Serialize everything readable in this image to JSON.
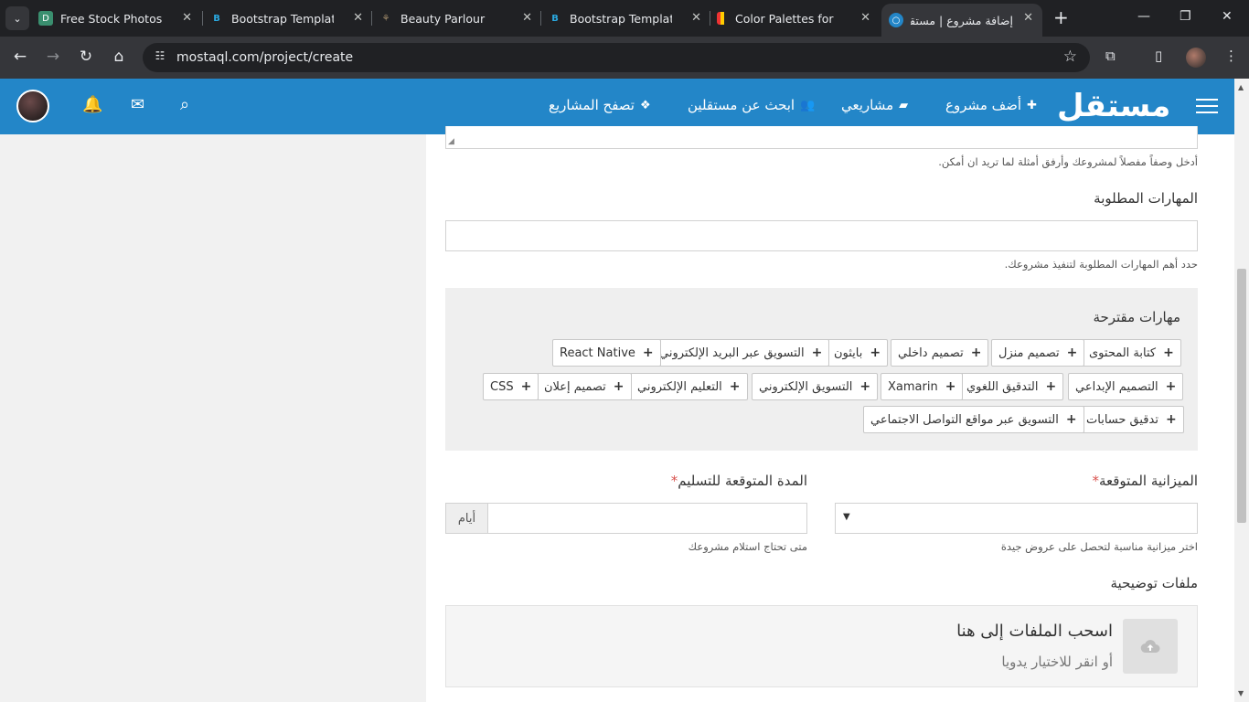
{
  "browser": {
    "tabs": [
      {
        "title": "Free Stock Photos, Ro",
        "favicon": "d-letter-icon"
      },
      {
        "title": "Bootstrap Templates |",
        "favicon": "bootstrap-icon"
      },
      {
        "title": "Beauty Parlour",
        "favicon": "plant-icon"
      },
      {
        "title": "Bootstrap Templates |",
        "favicon": "bootstrap-icon"
      },
      {
        "title": "Color Palettes for De",
        "favicon": "palette-icon"
      },
      {
        "title": "إضافة مشروع | مستقل",
        "favicon": "mostaql-icon",
        "active": true
      }
    ],
    "url": "mostaql.com/project/create"
  },
  "header": {
    "logo": "مستقل",
    "nav": [
      {
        "label": "أضف مشروع",
        "icon": "plus-icon"
      },
      {
        "label": "مشاريعي",
        "icon": "folder-open-icon"
      },
      {
        "label": "ابحث عن مستقلين",
        "icon": "users-icon"
      },
      {
        "label": "تصفح المشاريع",
        "icon": "cubes-icon"
      }
    ],
    "accent": "#2386c8"
  },
  "form": {
    "description_help": "أدخل وصفاً مفصلاً لمشروعك وأرفق أمثلة لما تريد ان أمكن.",
    "skills_label": "المهارات المطلوبة",
    "skills_value": "",
    "skills_help": "حدد أهم المهارات المطلوبة لتنفيذ مشروعك.",
    "suggested_title": "مهارات مقترحة",
    "suggested_skills": [
      "كتابة المحتوى",
      "تصميم منزل",
      "تصميم داخلي",
      "بايثون",
      "التسويق عبر البريد الإلكتروني",
      "React Native",
      "التصميم الإبداعي",
      "التدقيق اللغوي",
      "Xamarin",
      "التسويق الإلكتروني",
      "التعليم الإلكتروني",
      "تصميم إعلان",
      "CSS",
      "تدقيق حسابات",
      "التسويق عبر مواقع التواصل الاجتماعي"
    ],
    "budget_label": "الميزانية المتوقعة",
    "budget_required": "*",
    "budget_value": "",
    "budget_help": "اختر ميزانية مناسبة لتحصل على عروض جيدة",
    "duration_label": "المدة المتوقعة للتسليم",
    "duration_required": "*",
    "duration_value": "",
    "duration_unit": "أيام",
    "duration_help": "متى تحتاج استلام مشروعك",
    "files_label": "ملفات توضيحية",
    "dropzone_title": "اسحب الملفات إلى هنا",
    "dropzone_sub": "أو انقر للاختيار يدويا"
  }
}
